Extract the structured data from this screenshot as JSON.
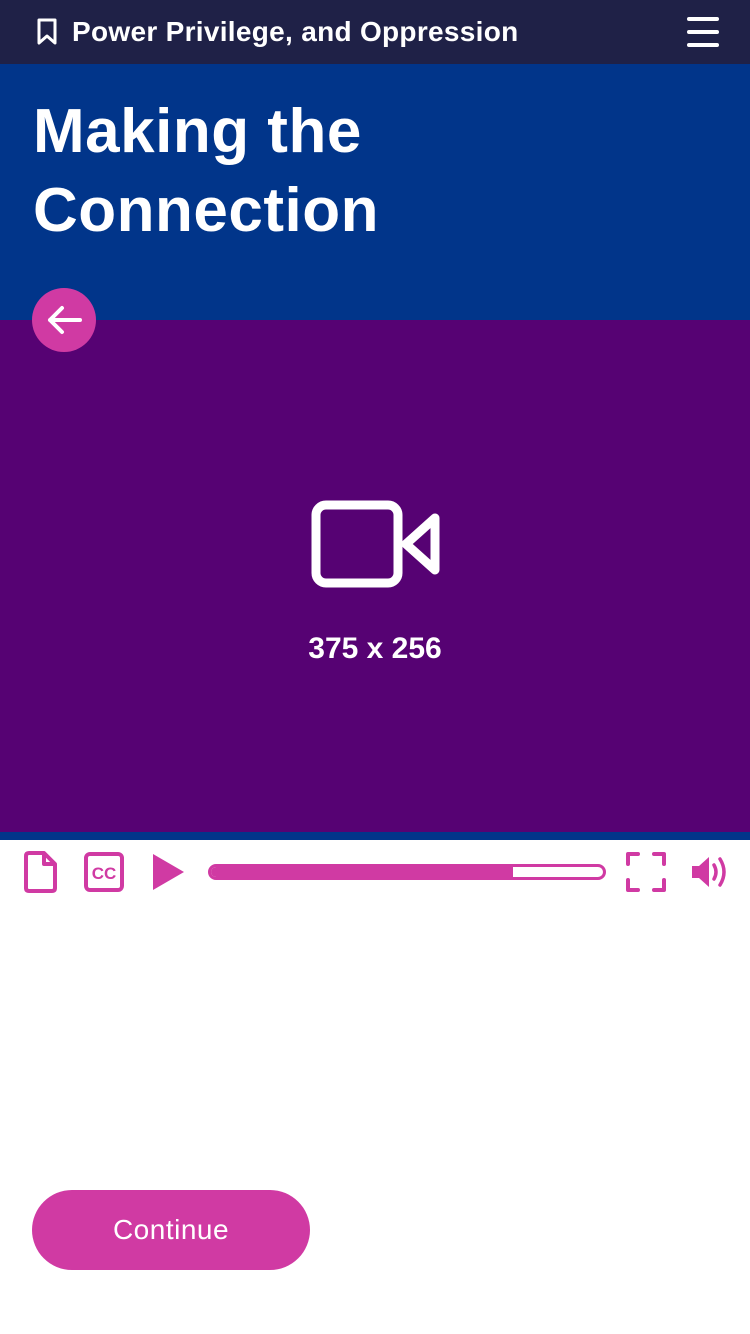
{
  "header": {
    "course_title": "Power Privilege, and Oppression",
    "bookmark_icon": "bookmark-icon",
    "menu_icon": "hamburger-menu-icon"
  },
  "hero": {
    "title": "Making the Connection",
    "back_icon": "arrow-left-icon"
  },
  "video": {
    "placeholder_icon": "video-camera-icon",
    "size_label": "375 x 256"
  },
  "player_controls": {
    "transcript_icon": "document-icon",
    "captions_icon": "closed-captions-icon",
    "play_icon": "play-icon",
    "progress": 0.77,
    "fullscreen_icon": "fullscreen-icon",
    "volume_icon": "volume-icon"
  },
  "footer": {
    "continue_label": "Continue"
  },
  "colors": {
    "header_bg": "#1f2147",
    "hero_bg": "#01358a",
    "video_bg": "#560273",
    "accent": "#d03aa3",
    "text_light": "#ffffff"
  }
}
